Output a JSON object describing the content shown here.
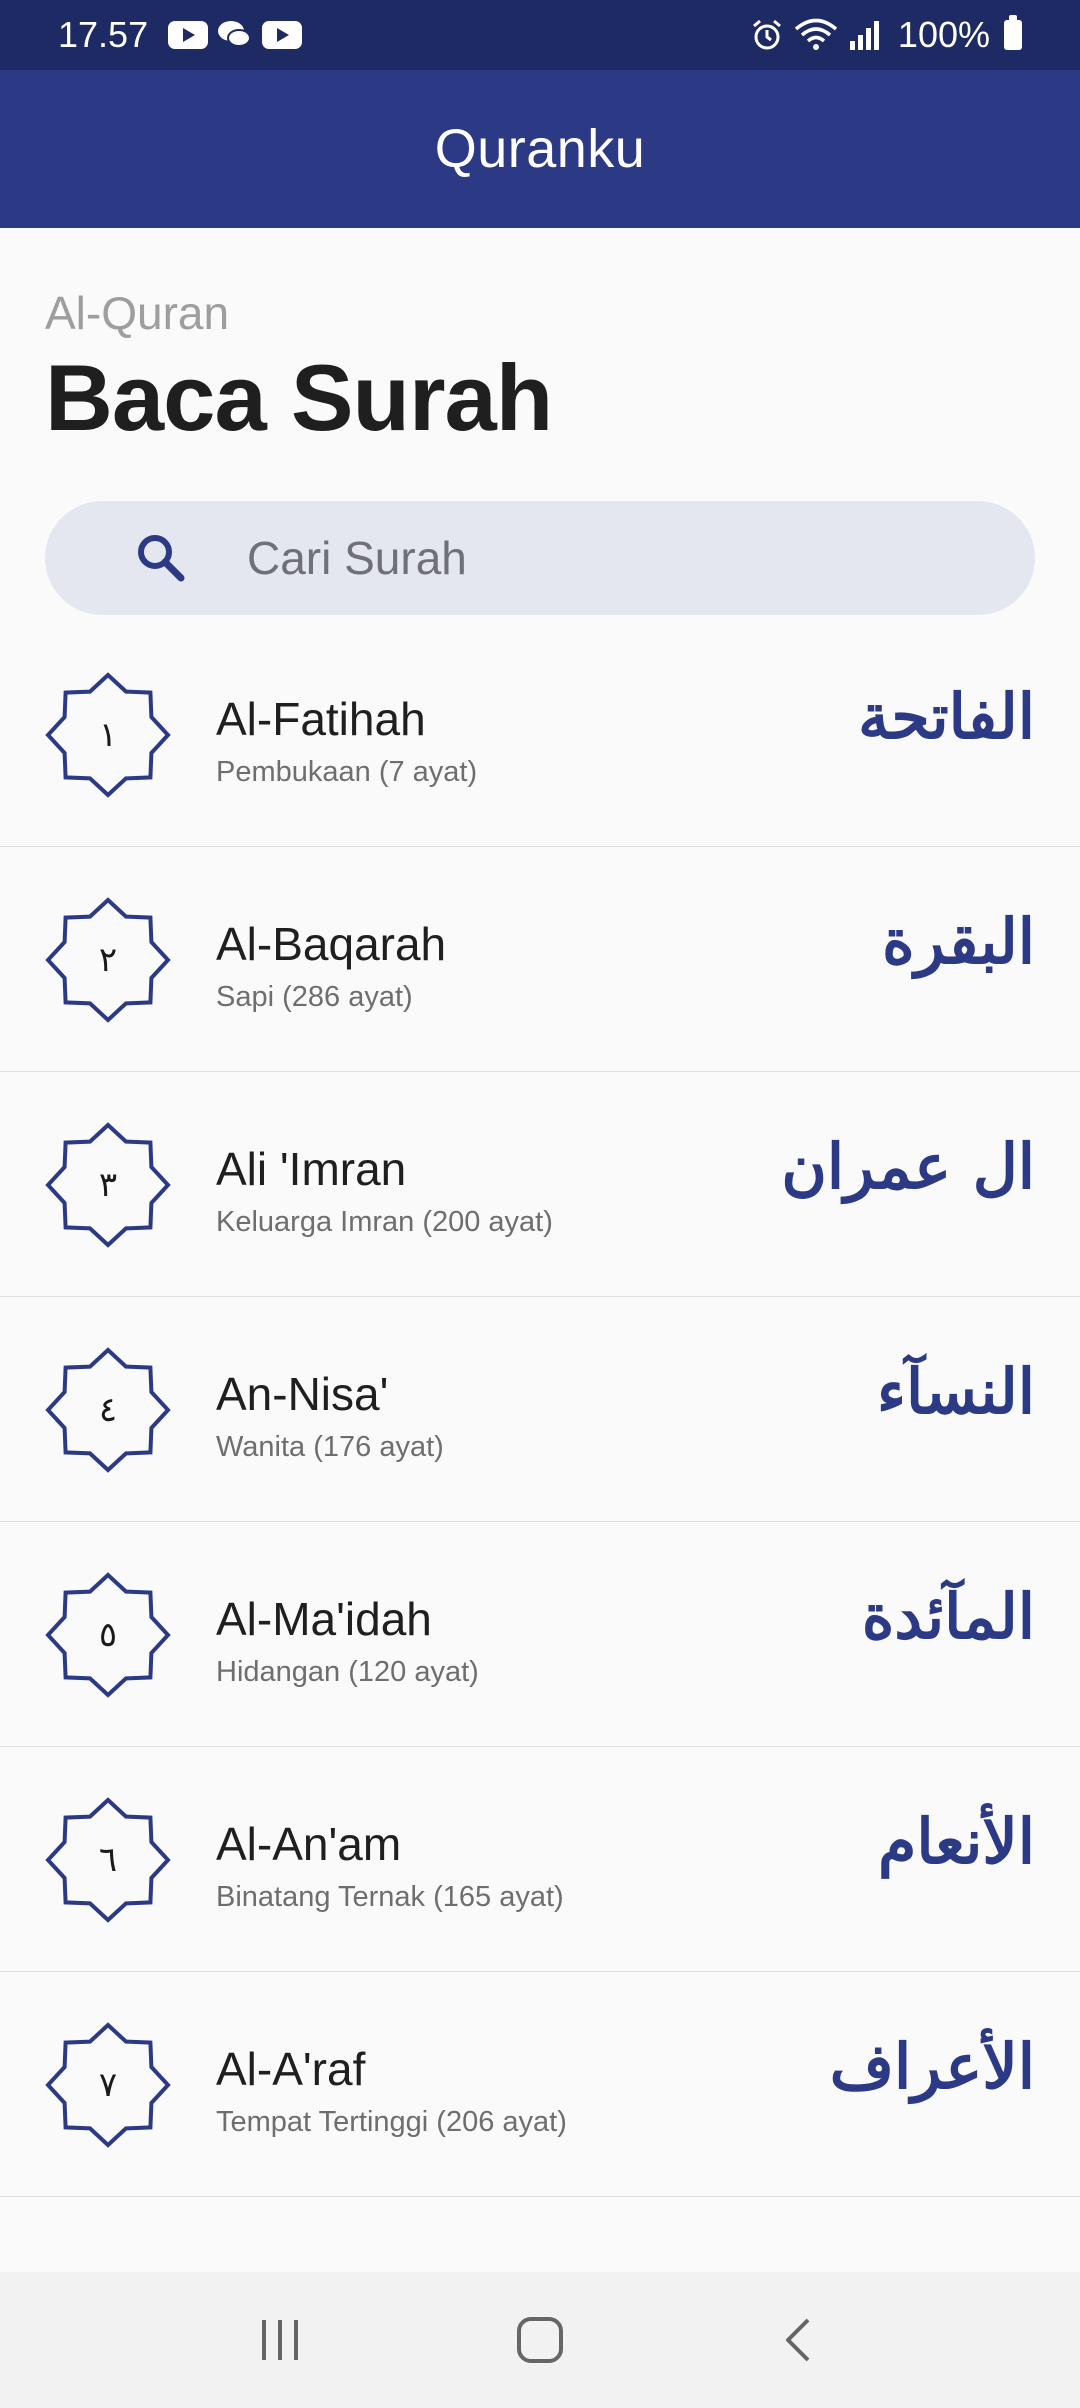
{
  "status_bar": {
    "time": "17.57",
    "battery": "100%",
    "notification_icons": [
      "youtube-icon",
      "chat-icon",
      "youtube-icon"
    ],
    "system_icons": [
      "alarm-icon",
      "wifi-icon",
      "signal-icon",
      "battery-icon"
    ]
  },
  "app_bar": {
    "title": "Quranku"
  },
  "header": {
    "subtitle": "Al-Quran",
    "title": "Baca Surah"
  },
  "search": {
    "placeholder": "Cari Surah",
    "value": ""
  },
  "surahs": [
    {
      "number": "١",
      "name": "Al-Fatihah",
      "meta": "Pembukaan (7 ayat)",
      "arabic": "الفاتحة"
    },
    {
      "number": "٢",
      "name": "Al-Baqarah",
      "meta": "Sapi (286 ayat)",
      "arabic": "البقرة"
    },
    {
      "number": "٣",
      "name": "Ali 'Imran",
      "meta": "Keluarga Imran (200 ayat)",
      "arabic": "ال عمران"
    },
    {
      "number": "٤",
      "name": "An-Nisa'",
      "meta": "Wanita (176 ayat)",
      "arabic": "النسآء"
    },
    {
      "number": "٥",
      "name": "Al-Ma'idah",
      "meta": "Hidangan (120 ayat)",
      "arabic": "المآئدة"
    },
    {
      "number": "٦",
      "name": "Al-An'am",
      "meta": "Binatang Ternak (165 ayat)",
      "arabic": "الأنعام"
    },
    {
      "number": "٧",
      "name": "Al-A'raf",
      "meta": "Tempat Tertinggi (206 ayat)",
      "arabic": "الأعراف"
    }
  ],
  "colors": {
    "status_bar": "#1e2a63",
    "app_bar": "#2c3a85",
    "accent": "#2c3a85",
    "search_bg": "#e4e7ef",
    "background": "#fafafa"
  },
  "nav_bar": {
    "icons": [
      "recents-icon",
      "home-icon",
      "back-icon"
    ]
  }
}
